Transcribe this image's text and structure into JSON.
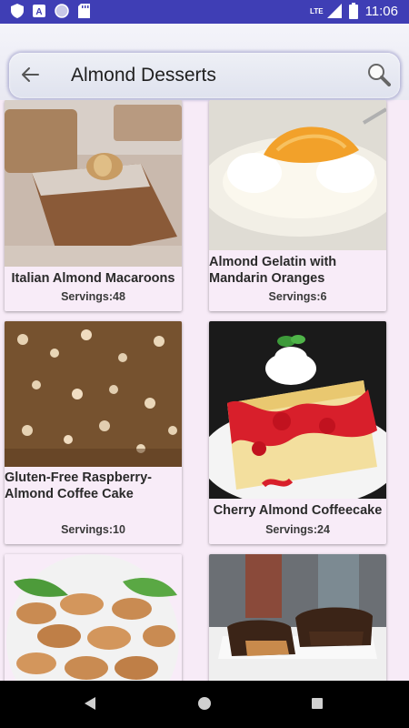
{
  "status_bar": {
    "time": "11:06",
    "network": "LTE",
    "icons": [
      "shield-icon",
      "a-badge-icon",
      "circle-icon",
      "sd-card-icon",
      "signal-icon",
      "battery-icon"
    ]
  },
  "search": {
    "query": "Almond Desserts",
    "back_icon": "arrow-left-icon",
    "search_icon": "magnifier-icon"
  },
  "recipes": [
    {
      "title": "Italian Almond Macaroons",
      "servings": "Servings:48"
    },
    {
      "title": "Almond Gelatin with Mandarin Oranges",
      "servings": "Servings:6"
    },
    {
      "title": "Gluten-Free Raspberry-Almond Coffee Cake",
      "servings": "Servings:10"
    },
    {
      "title": "Cherry Almond Coffeecake",
      "servings": "Servings:24"
    },
    {
      "title": "",
      "servings": ""
    },
    {
      "title": "",
      "servings": ""
    }
  ],
  "nav": {
    "back_icon": "triangle-back-icon",
    "home_icon": "circle-home-icon",
    "recents_icon": "square-recents-icon"
  },
  "colors": {
    "status_bar": "#3f3eb5",
    "background": "#f7ebf7",
    "nav_bar": "#000000"
  }
}
